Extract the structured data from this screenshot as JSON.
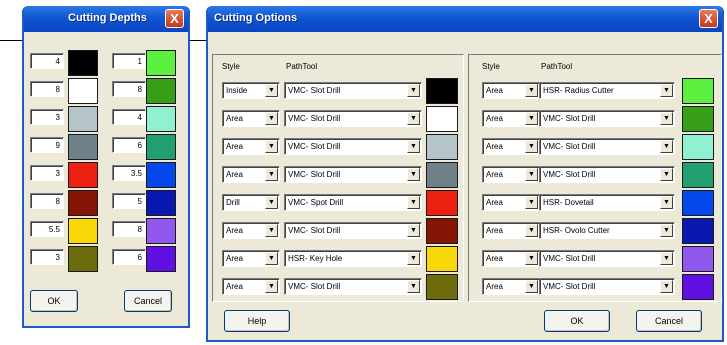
{
  "depths_dialog": {
    "title": "Cutting Depths",
    "close_label": "X",
    "left_column": [
      {
        "depth": "4",
        "color": "#000000"
      },
      {
        "depth": "8",
        "color": "#ffffff"
      },
      {
        "depth": "3",
        "color": "#b4c4c8"
      },
      {
        "depth": "9",
        "color": "#6e8088"
      },
      {
        "depth": "3",
        "color": "#ec2010"
      },
      {
        "depth": "8",
        "color": "#841404"
      },
      {
        "depth": "5.5",
        "color": "#f8d808"
      },
      {
        "depth": "3",
        "color": "#6c6c0c"
      }
    ],
    "right_column": [
      {
        "depth": "1",
        "color": "#5cf040"
      },
      {
        "depth": "8",
        "color": "#38a018"
      },
      {
        "depth": "4",
        "color": "#90f0d0"
      },
      {
        "depth": "6",
        "color": "#20a070"
      },
      {
        "depth": "3.5",
        "color": "#0448ec"
      },
      {
        "depth": "5",
        "color": "#0818b0"
      },
      {
        "depth": "8",
        "color": "#9058ec"
      },
      {
        "depth": "6",
        "color": "#6010e0"
      }
    ],
    "ok_label": "OK",
    "cancel_label": "Cancel"
  },
  "options_dialog": {
    "title": "Cutting Options",
    "close_label": "X",
    "style_header": "Style",
    "path_header": "PathTool",
    "left_rows": [
      {
        "style": "Inside",
        "path": "VMC- Slot Drill",
        "color": "#000000"
      },
      {
        "style": "Area",
        "path": "VMC- Slot Drill",
        "color": "#ffffff"
      },
      {
        "style": "Area",
        "path": "VMC- Slot Drill",
        "color": "#b4c4c8"
      },
      {
        "style": "Area",
        "path": "VMC- Slot Drill",
        "color": "#6e8088"
      },
      {
        "style": "Drill",
        "path": "VMC- Spot Drill",
        "color": "#ec2010"
      },
      {
        "style": "Area",
        "path": "VMC- Slot Drill",
        "color": "#841404"
      },
      {
        "style": "Area",
        "path": "HSR- Key Hole",
        "color": "#f8d808"
      },
      {
        "style": "Area",
        "path": "VMC- Slot Drill",
        "color": "#6c6c0c"
      }
    ],
    "right_rows": [
      {
        "style": "Area",
        "path": "HSR- Radius Cutter",
        "color": "#5cf040"
      },
      {
        "style": "Area",
        "path": "VMC- Slot Drill",
        "color": "#38a018"
      },
      {
        "style": "Area",
        "path": "VMC- Slot Drill",
        "color": "#90f0d0"
      },
      {
        "style": "Area",
        "path": "VMC- Slot Drill",
        "color": "#20a070"
      },
      {
        "style": "Area",
        "path": "HSR- Dovetail",
        "color": "#0448ec"
      },
      {
        "style": "Area",
        "path": "HSR- Ovolo Cutter",
        "color": "#0818b0"
      },
      {
        "style": "Area",
        "path": "VMC- Slot Drill",
        "color": "#9058ec"
      },
      {
        "style": "Area",
        "path": "VMC- Slot Drill",
        "color": "#6010e0"
      }
    ],
    "help_label": "Help",
    "ok_label": "OK",
    "cancel_label": "Cancel"
  }
}
